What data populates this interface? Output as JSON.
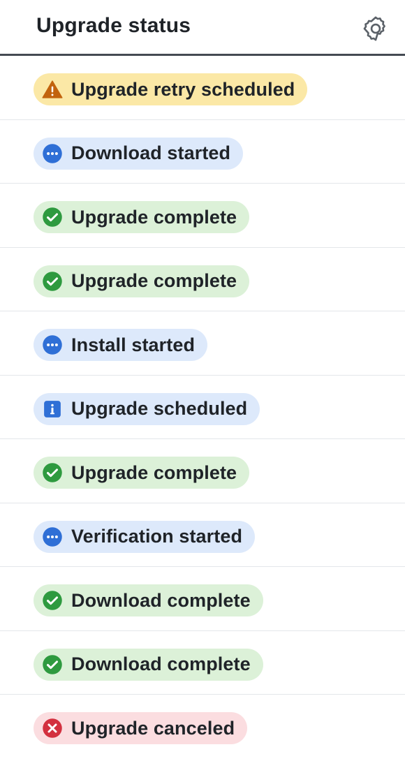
{
  "header": {
    "title": "Upgrade status",
    "settings_icon": "gear-icon"
  },
  "colors": {
    "warning_bg": "#fbe8a6",
    "warning_icon": "#c2630d",
    "progress_bg": "#dde9fb",
    "progress_icon": "#2f6fd6",
    "success_bg": "#dcf1d8",
    "success_icon": "#2e9a3f",
    "info_bg": "#dde9fb",
    "info_icon": "#2f6fd6",
    "error_bg": "#fbdde0",
    "error_icon": "#d3303f",
    "divider": "#e3e6ea",
    "header_rule": "#444a52"
  },
  "statuses": [
    {
      "label": "Upgrade retry scheduled",
      "kind": "warning",
      "icon": "warning-triangle-icon"
    },
    {
      "label": "Download started",
      "kind": "progress",
      "icon": "in-progress-icon"
    },
    {
      "label": "Upgrade complete",
      "kind": "success",
      "icon": "check-circle-icon"
    },
    {
      "label": "Upgrade complete",
      "kind": "success",
      "icon": "check-circle-icon"
    },
    {
      "label": "Install started",
      "kind": "progress",
      "icon": "in-progress-icon"
    },
    {
      "label": "Upgrade scheduled",
      "kind": "info",
      "icon": "info-square-icon"
    },
    {
      "label": "Upgrade complete",
      "kind": "success",
      "icon": "check-circle-icon"
    },
    {
      "label": "Verification started",
      "kind": "progress",
      "icon": "in-progress-icon"
    },
    {
      "label": "Download complete",
      "kind": "success",
      "icon": "check-circle-icon"
    },
    {
      "label": "Download complete",
      "kind": "success",
      "icon": "check-circle-icon"
    },
    {
      "label": "Upgrade canceled",
      "kind": "error",
      "icon": "x-circle-icon"
    }
  ]
}
